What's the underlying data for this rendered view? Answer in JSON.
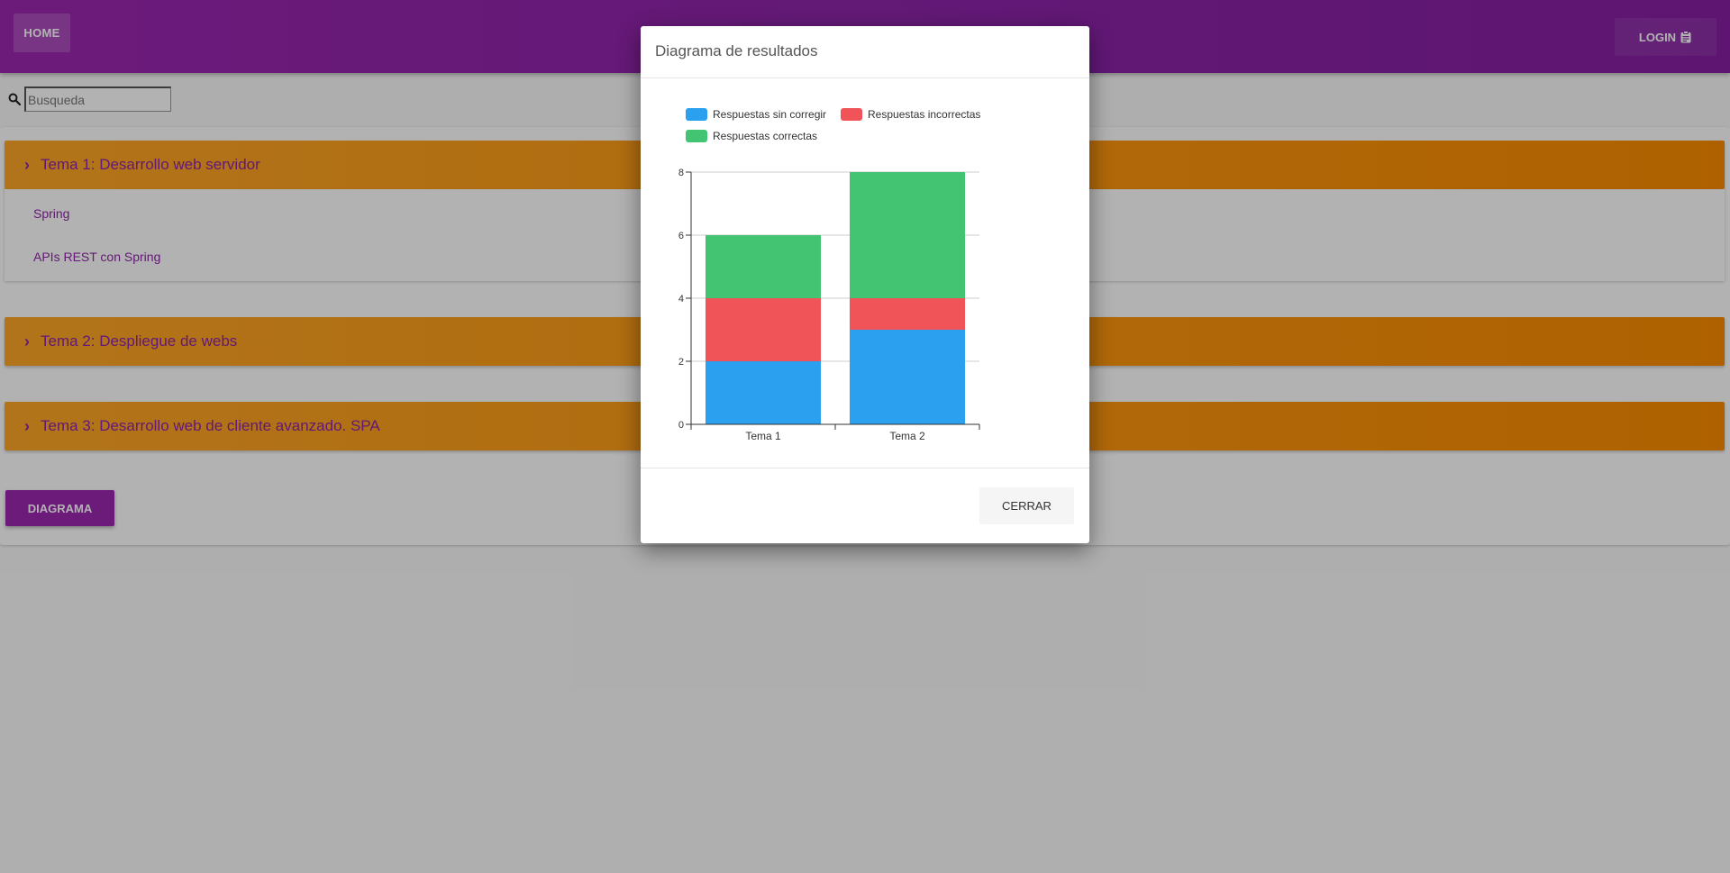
{
  "nav": {
    "home_label": "HOME",
    "login_label": "LOGIN"
  },
  "search": {
    "placeholder": "Busqueda"
  },
  "temas": [
    {
      "label": "Tema 1: Desarrollo web servidor",
      "items": [
        "Spring",
        "APIs REST con Spring"
      ]
    },
    {
      "label": "Tema 2: Despliegue de webs"
    },
    {
      "label": "Tema 3: Desarrollo web de cliente avanzado. SPA"
    }
  ],
  "diagrama_label": "DIAGRAMA",
  "modal": {
    "title": "Diagrama de resultados",
    "close_label": "CERRAR"
  },
  "colors": {
    "primary": "#9c27b0",
    "accent": "#fb8c00",
    "sin_corregir": "#2ba0ee",
    "incorrectas": "#f05458",
    "correctas": "#43c473"
  },
  "chart_data": {
    "type": "bar",
    "stacked": true,
    "categories": [
      "Tema 1",
      "Tema 2"
    ],
    "series": [
      {
        "name": "Respuestas sin corregir",
        "values": [
          2,
          3
        ],
        "color": "#2ba0ee"
      },
      {
        "name": "Respuestas incorrectas",
        "values": [
          2,
          1
        ],
        "color": "#f05458"
      },
      {
        "name": "Respuestas correctas",
        "values": [
          2,
          4
        ],
        "color": "#43c473"
      }
    ],
    "yticks": [
      "0",
      "2",
      "4",
      "6",
      "8"
    ],
    "ylim": [
      0,
      8
    ],
    "grid": true,
    "legend_position": "top-left"
  }
}
